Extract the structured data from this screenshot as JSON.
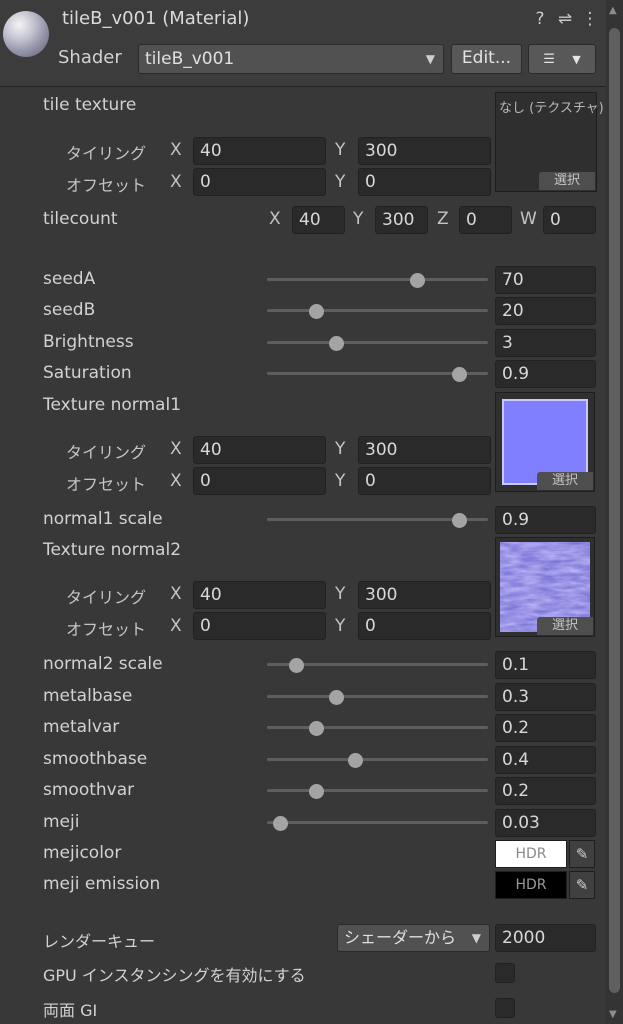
{
  "header": {
    "title": "tileB_v001 (Material)",
    "shader_label": "Shader",
    "shader_value": "tileB_v001",
    "edit_button": "Edit...",
    "help_icon": "?",
    "settings_icon": "⇌",
    "menu_icon": "⋮",
    "list_icon": "☰"
  },
  "tile_texture": {
    "label": "tile texture",
    "none_text": "なし (テクスチャ)",
    "select_label": "選択",
    "tiling_label": "タイリング",
    "offset_label": "オフセット",
    "tiling_x": "40",
    "tiling_y": "300",
    "offset_x": "0",
    "offset_y": "0"
  },
  "tilecount": {
    "label": "tilecount",
    "x": "40",
    "y": "300",
    "z": "0",
    "w": "0"
  },
  "axes": {
    "x": "X",
    "y": "Y",
    "z": "Z",
    "w": "W"
  },
  "sliders": [
    {
      "label": "seedA",
      "value": "70",
      "fraction": 0.68
    },
    {
      "label": "seedB",
      "value": "20",
      "fraction": 0.22
    },
    {
      "label": "Brightness",
      "value": "3",
      "fraction": 0.31
    },
    {
      "label": "Saturation",
      "value": "0.9",
      "fraction": 0.87
    }
  ],
  "normal1": {
    "label": "Texture normal1",
    "select_label": "選択",
    "tiling_label": "タイリング",
    "offset_label": "オフセット",
    "tiling_x": "40",
    "tiling_y": "300",
    "offset_x": "0",
    "offset_y": "0"
  },
  "normal1_scale": {
    "label": "normal1 scale",
    "value": "0.9",
    "fraction": 0.87
  },
  "normal2": {
    "label": "Texture normal2",
    "select_label": "選択",
    "tiling_label": "タイリング",
    "offset_label": "オフセット",
    "tiling_x": "40",
    "tiling_y": "300",
    "offset_x": "0",
    "offset_y": "0"
  },
  "sliders2": [
    {
      "label": "normal2 scale",
      "value": "0.1",
      "fraction": 0.13
    },
    {
      "label": "metalbase",
      "value": "0.3",
      "fraction": 0.31
    },
    {
      "label": "metalvar",
      "value": "0.2",
      "fraction": 0.22
    },
    {
      "label": "smoothbase",
      "value": "0.4",
      "fraction": 0.4
    },
    {
      "label": "smoothvar",
      "value": "0.2",
      "fraction": 0.22
    },
    {
      "label": "meji",
      "value": "0.03",
      "fraction": 0.06
    }
  ],
  "mejicolor": {
    "label": "mejicolor",
    "hdr": "HDR",
    "color": "#ffffff"
  },
  "meji_emission": {
    "label": "meji emission",
    "hdr": "HDR",
    "color": "#000000"
  },
  "render_queue": {
    "label": "レンダーキュー",
    "dropdown": "シェーダーから",
    "value": "2000"
  },
  "gpu_instancing": {
    "label": "GPU インスタンシングを有効にする"
  },
  "double_sided_gi": {
    "label": "両面 GI"
  },
  "colors": {
    "normal1_tex": "#7f7fff",
    "normal2_tex": "#8a86e6",
    "accent_bg": "#383838"
  }
}
